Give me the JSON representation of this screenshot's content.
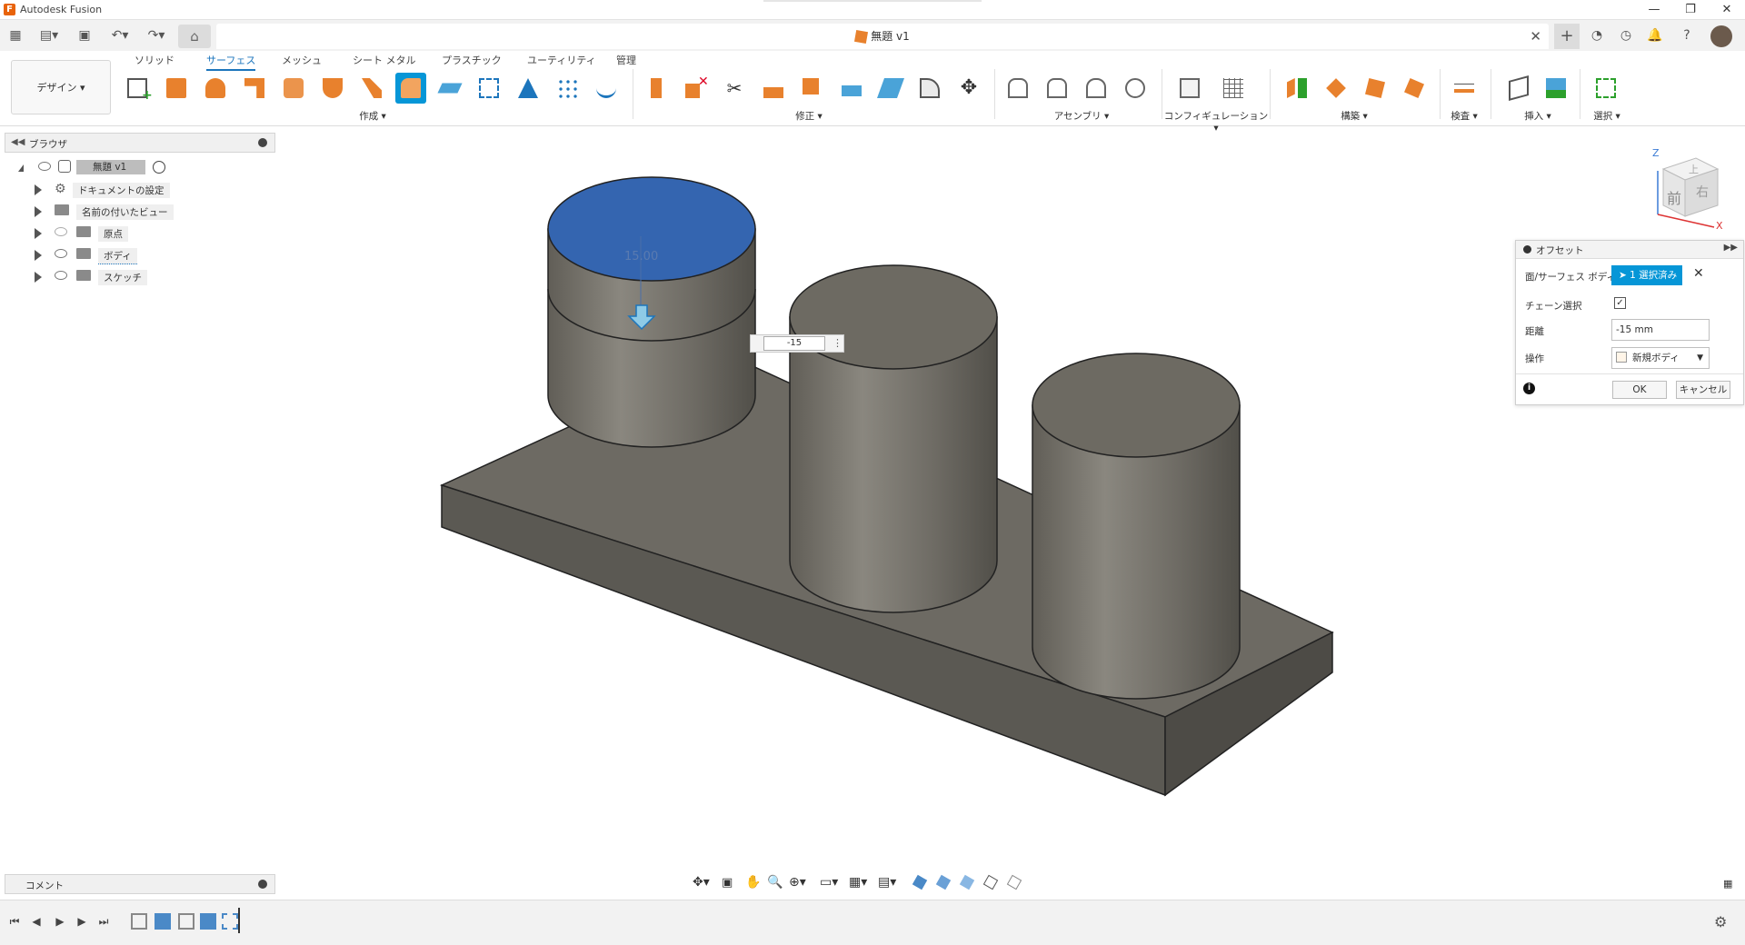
{
  "app": {
    "title": "Autodesk Fusion"
  },
  "document": {
    "tab_title": "無題 v1"
  },
  "ribbon": {
    "workspace": "デザイン ▾",
    "tabs": [
      "ソリッド",
      "サーフェス",
      "メッシュ",
      "シート メタル",
      "プラスチック",
      "ユーティリティ",
      "管理"
    ],
    "active_tab": "サーフェス",
    "groups": [
      "作成 ▾",
      "修正 ▾",
      "アセンブリ ▾",
      "コンフィギュレーション ▾",
      "構築 ▾",
      "検査 ▾",
      "挿入 ▾",
      "選択 ▾"
    ]
  },
  "browser": {
    "title": "ブラウザ",
    "root": "無題 v1",
    "items": [
      "ドキュメントの設定",
      "名前の付いたビュー",
      "原点",
      "ボディ",
      "スケッチ"
    ]
  },
  "comments": {
    "title": "コメント"
  },
  "offset_dialog": {
    "title": "オフセット",
    "face_label": "面/サーフェス ボディ",
    "selection": "1 選択済み",
    "chain_label": "チェーン選択",
    "distance_label": "距離",
    "distance_value": "-15 mm",
    "operation_label": "操作",
    "operation_value": "新規ボディ",
    "ok": "OK",
    "cancel": "キャンセル"
  },
  "viewport": {
    "dimension_input": "-15",
    "dimension_ghost": "15.00"
  },
  "viewcube": {
    "front": "前",
    "right": "右",
    "top": "上",
    "axis_x": "X",
    "axis_z": "Z"
  },
  "colors": {
    "accent": "#0696d7",
    "selection": "#3465b0",
    "body": "#737068",
    "tool_orange": "#e8812d"
  }
}
